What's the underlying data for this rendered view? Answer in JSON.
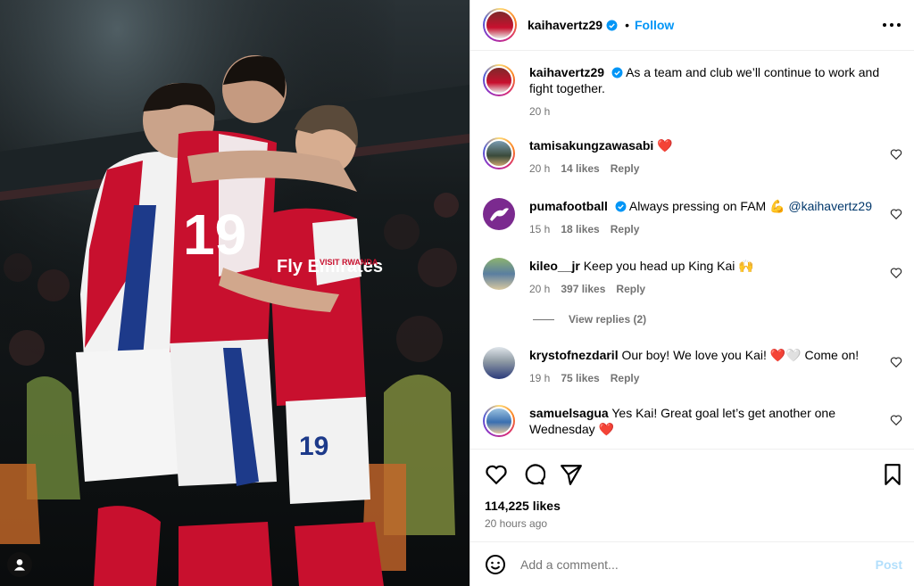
{
  "post": {
    "author": "kaihavertz29",
    "follow_label": "Follow",
    "dot": "•",
    "caption_user": "kaihavertz29",
    "caption_text": "As a team and club we’ll continue to work and fight together.",
    "caption_time": "20 h",
    "likes": "114,225 likes",
    "posted": "20 hours ago",
    "comment_placeholder": "Add a comment...",
    "post_label": "Post",
    "view_replies": "View replies (2)"
  },
  "comments": [
    {
      "user": "tamisakungzawasabi",
      "text": "❤️",
      "time": "20 h",
      "likes": "14 likes",
      "reply": "Reply"
    },
    {
      "user": "pumafootball",
      "text": "Always pressing on FAM 💪",
      "mention": "@kaihavertz29",
      "time": "15 h",
      "likes": "18 likes",
      "reply": "Reply"
    },
    {
      "user": "kileo__jr",
      "text": "Keep you head up King Kai 🙌",
      "time": "20 h",
      "likes": "397 likes",
      "reply": "Reply"
    },
    {
      "user": "krystofnezdaril",
      "text": "Our boy! We love you Kai! ❤️🤍 Come on!",
      "time": "19 h",
      "likes": "75 likes",
      "reply": "Reply"
    },
    {
      "user": "samuelsagua",
      "text": "Yes Kai! Great goal let’s get another one Wednesday ❤️"
    }
  ],
  "photo": {
    "shirt_numbers": [
      "19",
      "19"
    ],
    "sponsor": "Fly Emirates",
    "sleeve_sponsor": "VISIT RWANDA"
  },
  "colors": {
    "accent": "#0095f6",
    "verified": "#0095f6",
    "arsenal_red": "#c8102e",
    "muted_text": "#737373"
  },
  "icons": [
    "verified-badge-icon",
    "more-options-icon",
    "heart-icon",
    "comment-icon",
    "share-icon",
    "save-icon",
    "emoji-icon",
    "user-tag-icon"
  ]
}
